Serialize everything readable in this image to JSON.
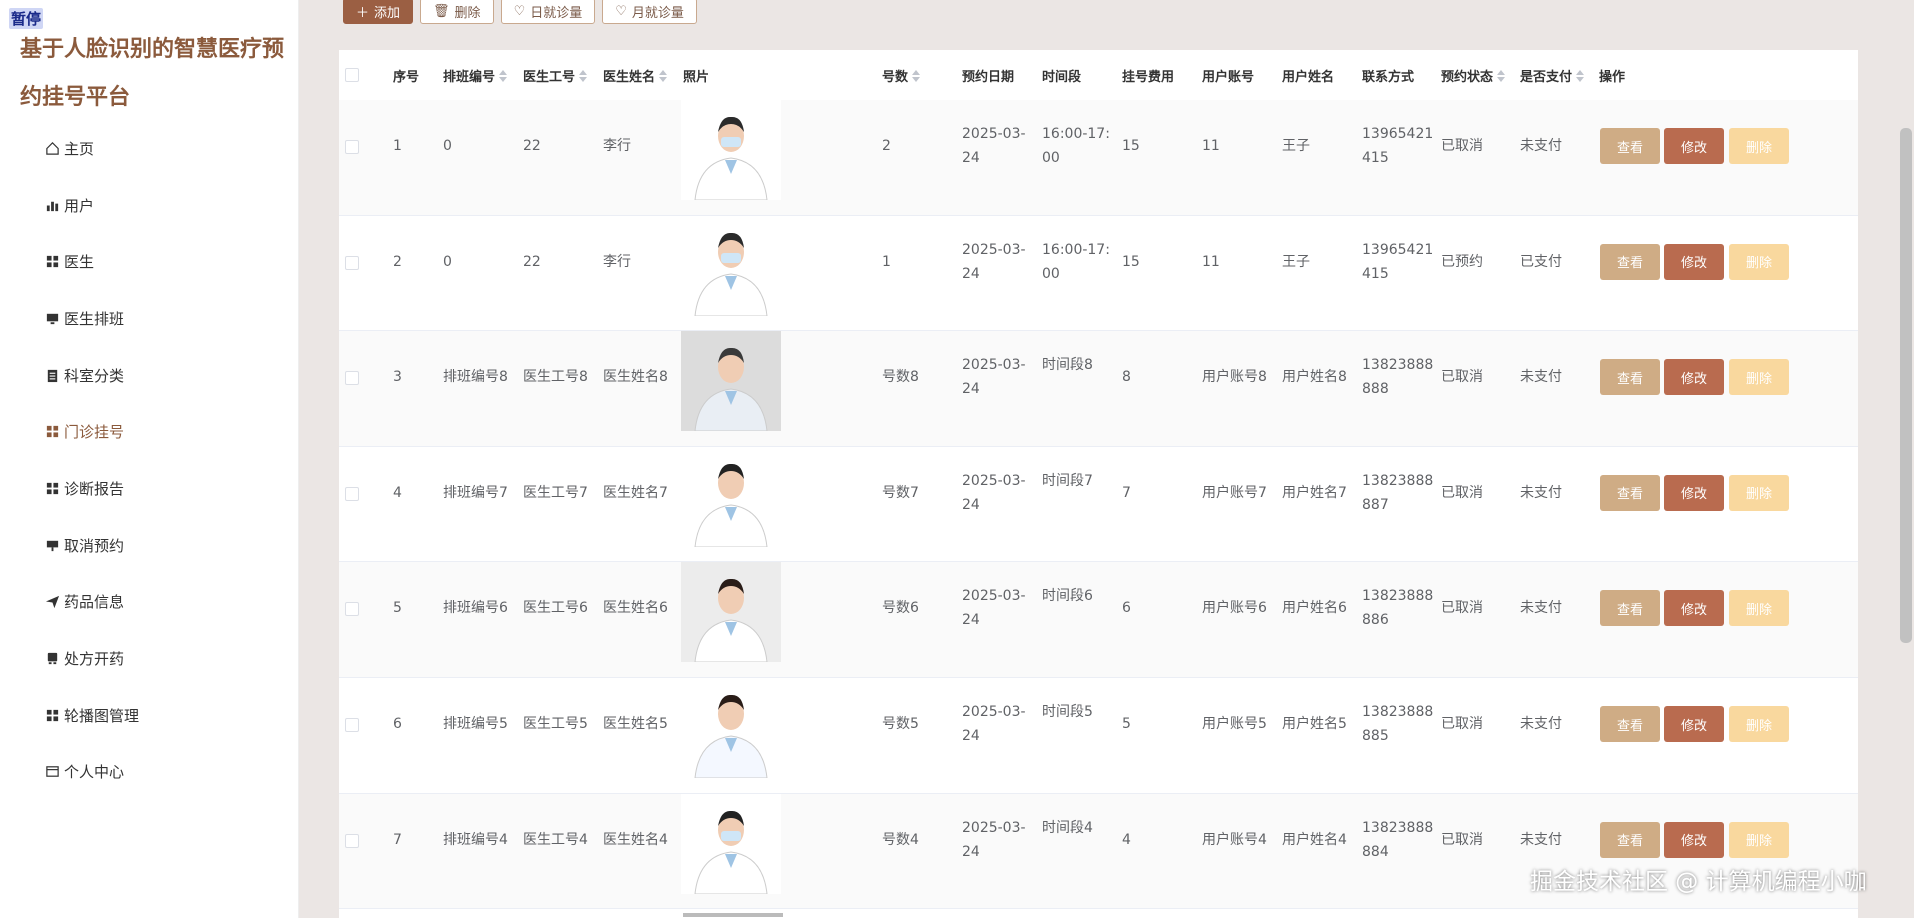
{
  "overlay": {
    "pause_badge": "暂停"
  },
  "brand": {
    "title": "基于人脸识别的智慧医疗预约挂号平台"
  },
  "menu": [
    {
      "label": "主页",
      "icon": "home-icon"
    },
    {
      "label": "用户",
      "icon": "bar-chart-icon"
    },
    {
      "label": "医生",
      "icon": "grid-icon"
    },
    {
      "label": "医生排班",
      "icon": "monitor-icon"
    },
    {
      "label": "科室分类",
      "icon": "clipboard-icon"
    },
    {
      "label": "门诊挂号",
      "icon": "grid-icon"
    },
    {
      "label": "诊断报告",
      "icon": "grid-icon"
    },
    {
      "label": "取消预约",
      "icon": "ticket-icon"
    },
    {
      "label": "药品信息",
      "icon": "send-icon"
    },
    {
      "label": "处方开药",
      "icon": "printer-icon"
    },
    {
      "label": "轮播图管理",
      "icon": "grid-icon"
    },
    {
      "label": "个人中心",
      "icon": "window-icon"
    }
  ],
  "toolbar": {
    "add": "添加",
    "delete": "删除",
    "daily": "日就诊量",
    "monthly": "月就诊量"
  },
  "columns": {
    "index": "序号",
    "schedule_no": "排班编号",
    "doctor_no": "医生工号",
    "doctor_name": "医生姓名",
    "photo": "照片",
    "number": "号数",
    "date": "预约日期",
    "time_slot": "时间段",
    "fee": "挂号费用",
    "user_account": "用户账号",
    "user_name": "用户姓名",
    "contact": "联系方式",
    "status": "预约状态",
    "paid": "是否支付",
    "actions": "操作"
  },
  "row_buttons": {
    "view": "查看",
    "edit": "修改",
    "delete": "删除"
  },
  "rows": [
    {
      "index": "1",
      "schedule_no": "0",
      "doctor_no": "22",
      "doctor_name": "李行",
      "number": "2",
      "date": "2025-03-24",
      "time_slot": "16:00-17:00",
      "fee": "15",
      "user_account": "11",
      "user_name": "王子",
      "contact": "13965421415",
      "status": "已取消",
      "paid": "未支付"
    },
    {
      "index": "2",
      "schedule_no": "0",
      "doctor_no": "22",
      "doctor_name": "李行",
      "number": "1",
      "date": "2025-03-24",
      "time_slot": "16:00-17:00",
      "fee": "15",
      "user_account": "11",
      "user_name": "王子",
      "contact": "13965421415",
      "status": "已预约",
      "paid": "已支付"
    },
    {
      "index": "3",
      "schedule_no": "排班编号8",
      "doctor_no": "医生工号8",
      "doctor_name": "医生姓名8",
      "number": "号数8",
      "date": "2025-03-24",
      "time_slot": "时间段8",
      "fee": "8",
      "user_account": "用户账号8",
      "user_name": "用户姓名8",
      "contact": "13823888888",
      "status": "已取消",
      "paid": "未支付"
    },
    {
      "index": "4",
      "schedule_no": "排班编号7",
      "doctor_no": "医生工号7",
      "doctor_name": "医生姓名7",
      "number": "号数7",
      "date": "2025-03-24",
      "time_slot": "时间段7",
      "fee": "7",
      "user_account": "用户账号7",
      "user_name": "用户姓名7",
      "contact": "13823888887",
      "status": "已取消",
      "paid": "未支付"
    },
    {
      "index": "5",
      "schedule_no": "排班编号6",
      "doctor_no": "医生工号6",
      "doctor_name": "医生姓名6",
      "number": "号数6",
      "date": "2025-03-24",
      "time_slot": "时间段6",
      "fee": "6",
      "user_account": "用户账号6",
      "user_name": "用户姓名6",
      "contact": "13823888886",
      "status": "已取消",
      "paid": "未支付"
    },
    {
      "index": "6",
      "schedule_no": "排班编号5",
      "doctor_no": "医生工号5",
      "doctor_name": "医生姓名5",
      "number": "号数5",
      "date": "2025-03-24",
      "time_slot": "时间段5",
      "fee": "5",
      "user_account": "用户账号5",
      "user_name": "用户姓名5",
      "contact": "13823888885",
      "status": "已取消",
      "paid": "未支付"
    },
    {
      "index": "7",
      "schedule_no": "排班编号4",
      "doctor_no": "医生工号4",
      "doctor_name": "医生姓名4",
      "number": "号数4",
      "date": "2025-03-24",
      "time_slot": "时间段4",
      "fee": "4",
      "user_account": "用户账号4",
      "user_name": "用户姓名4",
      "contact": "13823888884",
      "status": "已取消",
      "paid": "未支付"
    }
  ],
  "watermark": "掘金技术社区 @ 计算机编程小咖",
  "colors": {
    "brand": "#8b5a3c",
    "view_button": "#cfac85",
    "edit_button": "#b96b4f",
    "delete_button": "#f9d89e",
    "add_button": "#9b5f43"
  }
}
